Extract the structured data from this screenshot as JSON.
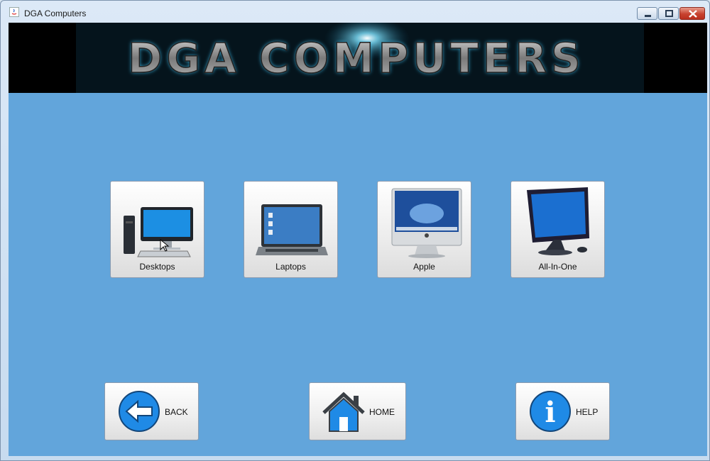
{
  "window": {
    "title": "DGA Computers",
    "controls": {
      "minimize": "minimize-icon",
      "maximize": "maximize-icon",
      "close": "close-icon"
    }
  },
  "banner": {
    "text": "DGA COMPUTERS",
    "glow_color": "#7fe3ff"
  },
  "categories": [
    {
      "label": "Desktops",
      "icon": "desktop-computer-icon"
    },
    {
      "label": "Laptops",
      "icon": "laptop-icon"
    },
    {
      "label": "Apple",
      "icon": "imac-icon"
    },
    {
      "label": "All-In-One",
      "icon": "all-in-one-icon"
    }
  ],
  "nav": {
    "back_label": "BACK",
    "home_label": "HOME",
    "help_label": "HELP"
  },
  "colors": {
    "background": "#62a5db",
    "accent": "#1f8ae6"
  }
}
